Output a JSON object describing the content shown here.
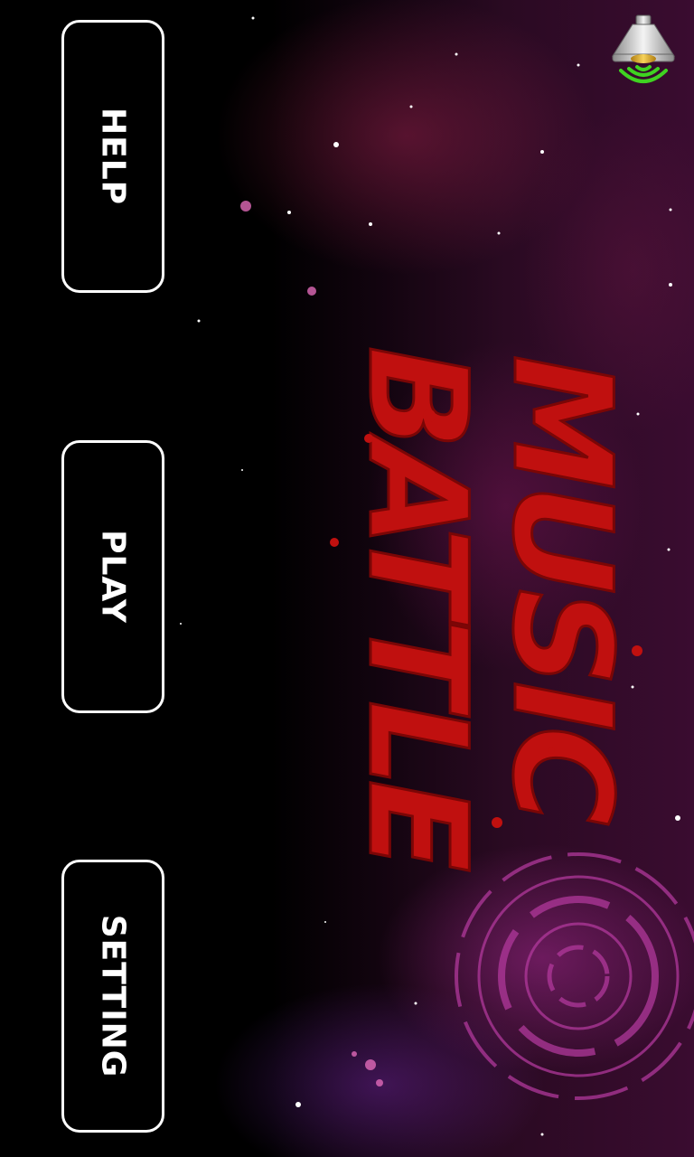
{
  "menu": {
    "help_label": "HELP",
    "play_label": "PLAY",
    "setting_label": "SETTING"
  },
  "title": {
    "line1": "MUSIC",
    "line2": "BATTLE",
    "color": "#c0100f"
  },
  "sound": {
    "icon": "speaker-icon",
    "state": "on",
    "wave_color": "#3fd321"
  }
}
